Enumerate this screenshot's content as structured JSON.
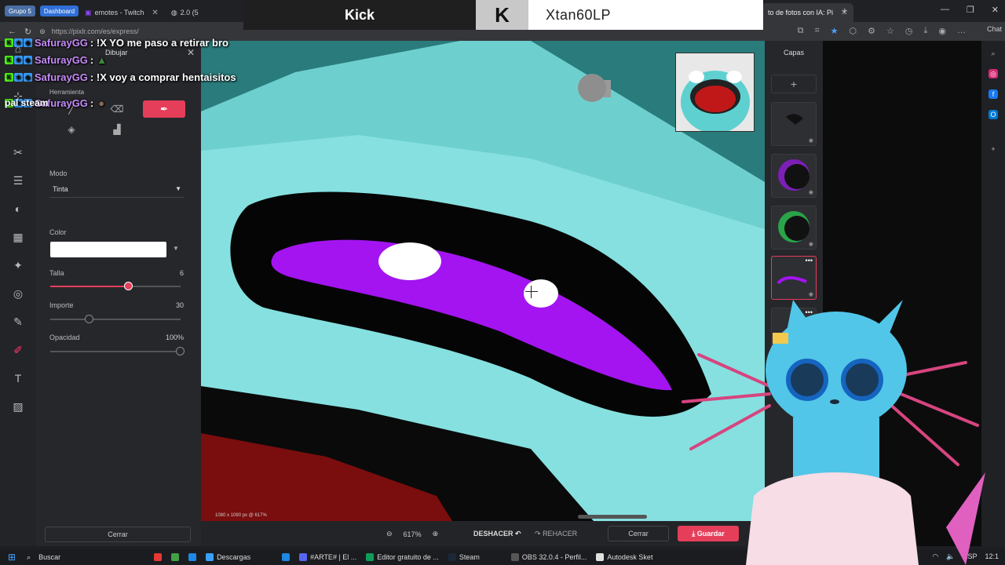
{
  "browser": {
    "group_chip": "Grupo 5",
    "dashboard_chip": "Dashboard",
    "tabs": [
      {
        "label": "emotes - Twitch"
      },
      {
        "label": "2.0 (5"
      },
      {
        "label": "to de fotos con IA: Pi"
      }
    ],
    "url": "https://pixlr.com/es/express/",
    "chat_button": "Chat"
  },
  "kick": {
    "label": "Kick",
    "logo": "K",
    "username": "Xtan60LP"
  },
  "chat": {
    "messages": [
      {
        "user": "SafurayGG",
        "text": ": !X YO me paso a retirar bro"
      },
      {
        "user": "SafurayGG",
        "text": ":"
      },
      {
        "user": "SafurayGG",
        "text": ": !X voy a comprar hentaisitos"
      },
      {
        "user": "SafurayGG",
        "text": ":"
      }
    ],
    "continuation": "pal steam"
  },
  "draw_panel": {
    "title": "Dibujar",
    "tool_label": "Herramienta",
    "mode_label": "Modo",
    "mode_value": "Tinta",
    "color_label": "Color",
    "color_value": "#ffffff",
    "size_label": "Talla",
    "size_value": "6",
    "size_fraction": 0.6,
    "importe_label": "Importe",
    "importe_value": "30",
    "importe_fraction": 0.3,
    "opacity_label": "Opacidad",
    "opacity_value": "100%",
    "opacity_fraction": 1.0,
    "close_label": "Cerrar"
  },
  "canvas": {
    "status": "1080 x 1080 px @ 617%"
  },
  "layers": {
    "title": "Capas"
  },
  "bottom": {
    "zoom": "617%",
    "undo": "DESHACER",
    "redo": "REHACER",
    "close": "Cerrar",
    "save": "Guardar"
  },
  "taskbar": {
    "search": "Buscar",
    "apps": [
      {
        "label": "Descargas"
      },
      {
        "label": "#ARTE# | El ..."
      },
      {
        "label": "Editor gratuito de ..."
      },
      {
        "label": "Steam"
      },
      {
        "label": "OBS 32.0.4 - Perfil..."
      },
      {
        "label": "Autodesk Sket"
      }
    ],
    "lang": "ESP",
    "time": "12:1"
  },
  "colors": {
    "accent": "#e53e5a",
    "username": "#c58af9",
    "canvas_teal": "#7fd6d6",
    "stroke_purple": "#a314f0"
  }
}
